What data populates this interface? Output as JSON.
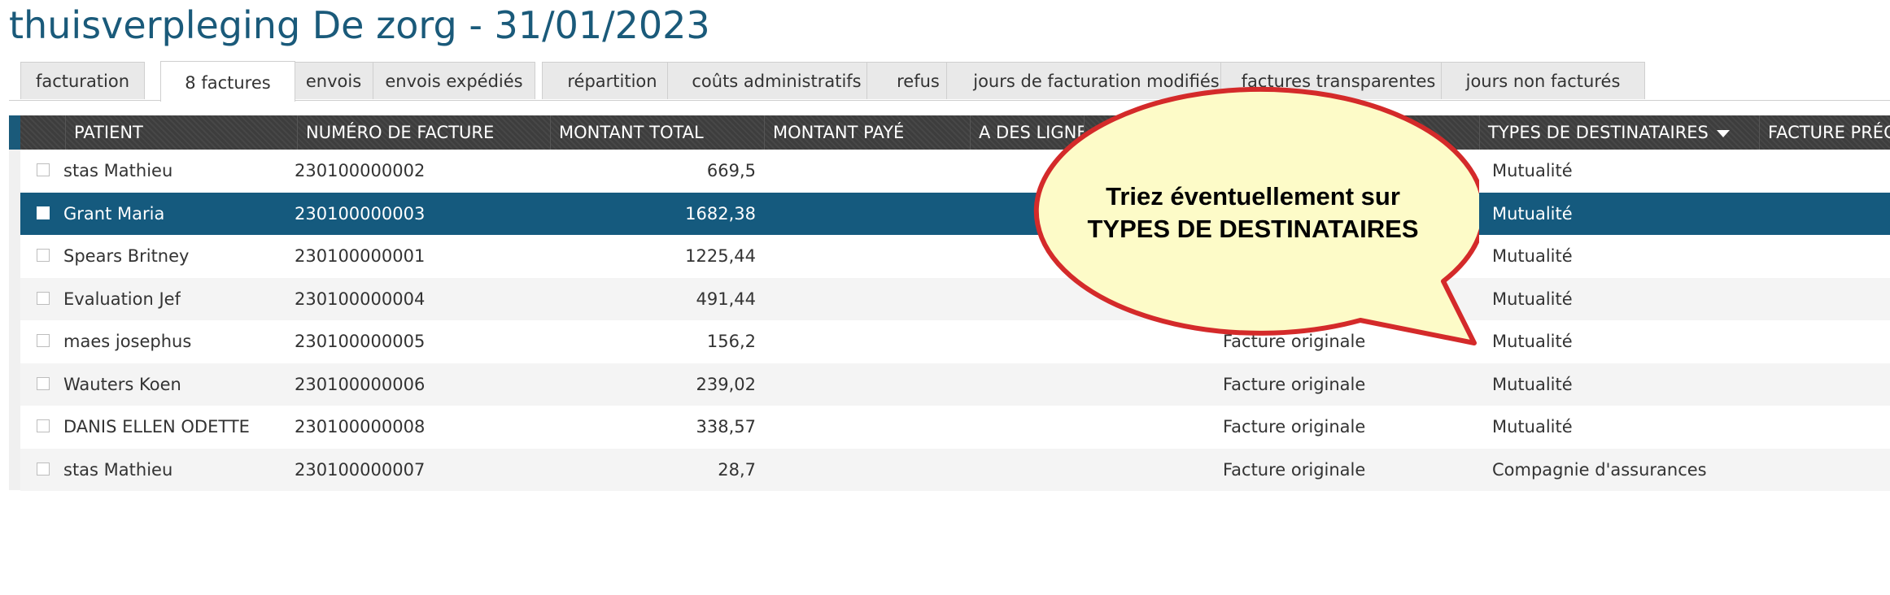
{
  "page_title": "thuisverpleging De zorg - 31/01/2023",
  "tabs": [
    {
      "label": "facturation"
    },
    {
      "label": "8 factures"
    },
    {
      "label": "envois"
    },
    {
      "label": "envois expédiés"
    },
    {
      "label": "répartition"
    },
    {
      "label": "coûts administratifs"
    },
    {
      "label": "refus"
    },
    {
      "label": "jours de facturation modifiés"
    },
    {
      "label": "factures transparentes"
    },
    {
      "label": "jours non facturés"
    }
  ],
  "active_tab": "8 factures",
  "columns": {
    "patient": "PATIENT",
    "invoice_number": "NUMÉRO DE FACTURE",
    "total": "MONTANT TOTAL",
    "paid": "MONTANT PAYÉ",
    "has_lines": "A DES LIGNES",
    "recipients": "TYPES DE DESTINATAIRES",
    "previous": "FACTURE PRÉCÉ"
  },
  "rows": [
    {
      "patient": "stas Mathieu",
      "number": "230100000002",
      "total": "669,5",
      "type": "",
      "recipient": "Mutualité"
    },
    {
      "patient": "Grant Maria",
      "number": "230100000003",
      "total": "1682,38",
      "type": "",
      "recipient": "Mutualité"
    },
    {
      "patient": "Spears Britney",
      "number": "230100000001",
      "total": "1225,44",
      "type": "",
      "recipient": "Mutualité"
    },
    {
      "patient": "Evaluation Jef",
      "number": "230100000004",
      "total": "491,44",
      "type": "",
      "recipient": "Mutualité"
    },
    {
      "patient": "maes josephus",
      "number": "230100000005",
      "total": "156,2",
      "type": "Facture originale",
      "recipient": "Mutualité"
    },
    {
      "patient": "Wauters Koen",
      "number": "230100000006",
      "total": "239,02",
      "type": "Facture originale",
      "recipient": "Mutualité"
    },
    {
      "patient": "DANIS ELLEN ODETTE",
      "number": "230100000008",
      "total": "338,57",
      "type": "Facture originale",
      "recipient": "Mutualité"
    },
    {
      "patient": "stas Mathieu",
      "number": "230100000007",
      "total": "28,7",
      "type": "Facture originale",
      "recipient": "Compagnie d'assurances"
    }
  ],
  "selected_row": "Grant Maria",
  "callout": {
    "line1": "Triez éventuellement sur",
    "line2": "TYPES DE DESTINATAIRES"
  },
  "colors": {
    "title": "#1a5a7a",
    "selected_row": "#155a7e",
    "header": "#3d3d3d",
    "callout_fill": "#fdfbc8",
    "callout_border": "#d42a2a"
  }
}
